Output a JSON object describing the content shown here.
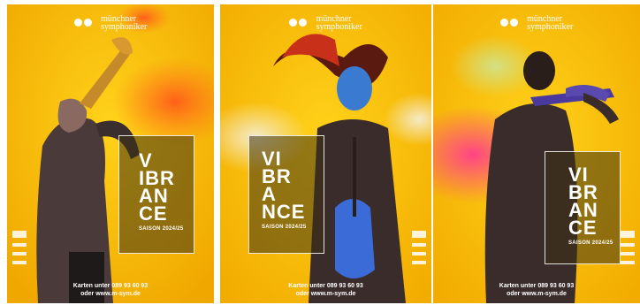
{
  "posters": [
    {
      "logo_line1": "münchner",
      "logo_line2": "symphoniker",
      "title_lines": [
        "V",
        "IBR",
        "AN",
        "CE"
      ],
      "season": "SAISON 2024/25",
      "contact_line1": "Karten unter 089 93 60 93",
      "contact_line2": "oder www.m-sym.de",
      "subject": "trumpet player"
    },
    {
      "logo_line1": "münchner",
      "logo_line2": "symphoniker",
      "title_lines": [
        "VI",
        "BR",
        "A",
        "NCE"
      ],
      "season": "SAISON 2024/25",
      "contact_line1": "Karten unter 089 93 60 93",
      "contact_line2": "oder www.m-sym.de",
      "subject": "violinist with flying hair"
    },
    {
      "logo_line1": "münchner",
      "logo_line2": "symphoniker",
      "title_lines": [
        "VI",
        "BR",
        "AN",
        "CE"
      ],
      "season": "SAISON 2024/25",
      "contact_line1": "Karten unter 089 93 60 93",
      "contact_line2": "oder www.m-sym.de",
      "subject": "violinist with pink powder"
    }
  ],
  "colors": {
    "background": "#f5c200",
    "accent_orange": "#ff6a1a",
    "accent_pink": "#ff3d8c",
    "accent_blue": "#3a6bd6"
  }
}
